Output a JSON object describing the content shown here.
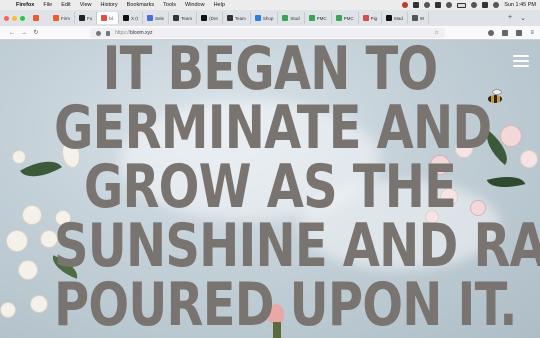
{
  "menubar": {
    "app": "Firefox",
    "items": [
      "File",
      "Edit",
      "View",
      "History",
      "Bookmarks",
      "Tools",
      "Window",
      "Help"
    ],
    "clock": "Sun 1:45 PM"
  },
  "tabs": [
    {
      "label": "Firm",
      "color": "#e85d2b"
    },
    {
      "label": "Fo",
      "color": "#222222"
    },
    {
      "label": "bl.",
      "color": "#e04b4b",
      "active": true
    },
    {
      "label": "X (t",
      "color": "#111111"
    },
    {
      "label": "Sele",
      "color": "#4a6ee0"
    },
    {
      "label": "Team",
      "color": "#333333"
    },
    {
      "label": "(Dre",
      "color": "#111111"
    },
    {
      "label": "Team",
      "color": "#333333"
    },
    {
      "label": "Shop",
      "color": "#2e7de0"
    },
    {
      "label": "Stud",
      "color": "#3aa655"
    },
    {
      "label": "PMC",
      "color": "#3aa655"
    },
    {
      "label": "PMC",
      "color": "#3aa655"
    },
    {
      "label": "Pig",
      "color": "#d94a4a"
    },
    {
      "label": "Mad",
      "color": "#111111"
    },
    {
      "label": "W",
      "color": "#555555"
    }
  ],
  "toolbar": {
    "back": "←",
    "forward": "→",
    "reload": "↻",
    "url_prefix": "https://",
    "url_host": "bloom.xyz",
    "star": "☆",
    "new_tab": "+",
    "tab_list": "⌄"
  },
  "hero": {
    "lines": [
      "IT BEGAN TO",
      "GERMINATE AND",
      "GROW AS THE",
      "SUNSHINE AND RAIN",
      "POURED UPON IT."
    ]
  },
  "icons": {
    "menu": "hamburger-menu-icon"
  }
}
